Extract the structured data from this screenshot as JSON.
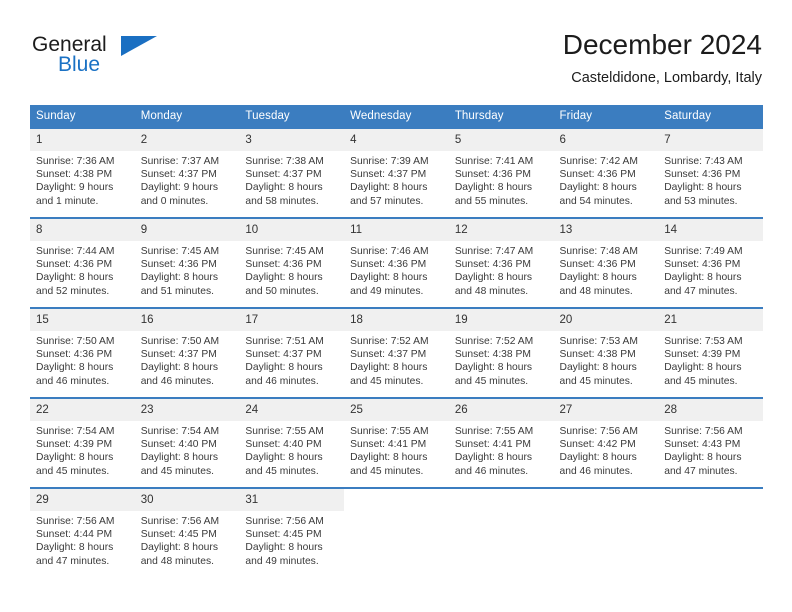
{
  "brand": {
    "word_top": "General",
    "word_bottom": "Blue",
    "accent_color": "#1a6fc2",
    "logo_icon": "triangle-logo-icon"
  },
  "header": {
    "month_title": "December 2024",
    "location": "Casteldidone, Lombardy, Italy"
  },
  "calendar": {
    "header_bg": "#3b7dc0",
    "daynum_bg": "#f0f0f0",
    "weekday_headers": [
      "Sunday",
      "Monday",
      "Tuesday",
      "Wednesday",
      "Thursday",
      "Friday",
      "Saturday"
    ],
    "weeks": [
      [
        {
          "day": "1",
          "sunrise": "Sunrise: 7:36 AM",
          "sunset": "Sunset: 4:38 PM",
          "daylight_line1": "Daylight: 9 hours",
          "daylight_line2": "and 1 minute."
        },
        {
          "day": "2",
          "sunrise": "Sunrise: 7:37 AM",
          "sunset": "Sunset: 4:37 PM",
          "daylight_line1": "Daylight: 9 hours",
          "daylight_line2": "and 0 minutes."
        },
        {
          "day": "3",
          "sunrise": "Sunrise: 7:38 AM",
          "sunset": "Sunset: 4:37 PM",
          "daylight_line1": "Daylight: 8 hours",
          "daylight_line2": "and 58 minutes."
        },
        {
          "day": "4",
          "sunrise": "Sunrise: 7:39 AM",
          "sunset": "Sunset: 4:37 PM",
          "daylight_line1": "Daylight: 8 hours",
          "daylight_line2": "and 57 minutes."
        },
        {
          "day": "5",
          "sunrise": "Sunrise: 7:41 AM",
          "sunset": "Sunset: 4:36 PM",
          "daylight_line1": "Daylight: 8 hours",
          "daylight_line2": "and 55 minutes."
        },
        {
          "day": "6",
          "sunrise": "Sunrise: 7:42 AM",
          "sunset": "Sunset: 4:36 PM",
          "daylight_line1": "Daylight: 8 hours",
          "daylight_line2": "and 54 minutes."
        },
        {
          "day": "7",
          "sunrise": "Sunrise: 7:43 AM",
          "sunset": "Sunset: 4:36 PM",
          "daylight_line1": "Daylight: 8 hours",
          "daylight_line2": "and 53 minutes."
        }
      ],
      [
        {
          "day": "8",
          "sunrise": "Sunrise: 7:44 AM",
          "sunset": "Sunset: 4:36 PM",
          "daylight_line1": "Daylight: 8 hours",
          "daylight_line2": "and 52 minutes."
        },
        {
          "day": "9",
          "sunrise": "Sunrise: 7:45 AM",
          "sunset": "Sunset: 4:36 PM",
          "daylight_line1": "Daylight: 8 hours",
          "daylight_line2": "and 51 minutes."
        },
        {
          "day": "10",
          "sunrise": "Sunrise: 7:45 AM",
          "sunset": "Sunset: 4:36 PM",
          "daylight_line1": "Daylight: 8 hours",
          "daylight_line2": "and 50 minutes."
        },
        {
          "day": "11",
          "sunrise": "Sunrise: 7:46 AM",
          "sunset": "Sunset: 4:36 PM",
          "daylight_line1": "Daylight: 8 hours",
          "daylight_line2": "and 49 minutes."
        },
        {
          "day": "12",
          "sunrise": "Sunrise: 7:47 AM",
          "sunset": "Sunset: 4:36 PM",
          "daylight_line1": "Daylight: 8 hours",
          "daylight_line2": "and 48 minutes."
        },
        {
          "day": "13",
          "sunrise": "Sunrise: 7:48 AM",
          "sunset": "Sunset: 4:36 PM",
          "daylight_line1": "Daylight: 8 hours",
          "daylight_line2": "and 48 minutes."
        },
        {
          "day": "14",
          "sunrise": "Sunrise: 7:49 AM",
          "sunset": "Sunset: 4:36 PM",
          "daylight_line1": "Daylight: 8 hours",
          "daylight_line2": "and 47 minutes."
        }
      ],
      [
        {
          "day": "15",
          "sunrise": "Sunrise: 7:50 AM",
          "sunset": "Sunset: 4:36 PM",
          "daylight_line1": "Daylight: 8 hours",
          "daylight_line2": "and 46 minutes."
        },
        {
          "day": "16",
          "sunrise": "Sunrise: 7:50 AM",
          "sunset": "Sunset: 4:37 PM",
          "daylight_line1": "Daylight: 8 hours",
          "daylight_line2": "and 46 minutes."
        },
        {
          "day": "17",
          "sunrise": "Sunrise: 7:51 AM",
          "sunset": "Sunset: 4:37 PM",
          "daylight_line1": "Daylight: 8 hours",
          "daylight_line2": "and 46 minutes."
        },
        {
          "day": "18",
          "sunrise": "Sunrise: 7:52 AM",
          "sunset": "Sunset: 4:37 PM",
          "daylight_line1": "Daylight: 8 hours",
          "daylight_line2": "and 45 minutes."
        },
        {
          "day": "19",
          "sunrise": "Sunrise: 7:52 AM",
          "sunset": "Sunset: 4:38 PM",
          "daylight_line1": "Daylight: 8 hours",
          "daylight_line2": "and 45 minutes."
        },
        {
          "day": "20",
          "sunrise": "Sunrise: 7:53 AM",
          "sunset": "Sunset: 4:38 PM",
          "daylight_line1": "Daylight: 8 hours",
          "daylight_line2": "and 45 minutes."
        },
        {
          "day": "21",
          "sunrise": "Sunrise: 7:53 AM",
          "sunset": "Sunset: 4:39 PM",
          "daylight_line1": "Daylight: 8 hours",
          "daylight_line2": "and 45 minutes."
        }
      ],
      [
        {
          "day": "22",
          "sunrise": "Sunrise: 7:54 AM",
          "sunset": "Sunset: 4:39 PM",
          "daylight_line1": "Daylight: 8 hours",
          "daylight_line2": "and 45 minutes."
        },
        {
          "day": "23",
          "sunrise": "Sunrise: 7:54 AM",
          "sunset": "Sunset: 4:40 PM",
          "daylight_line1": "Daylight: 8 hours",
          "daylight_line2": "and 45 minutes."
        },
        {
          "day": "24",
          "sunrise": "Sunrise: 7:55 AM",
          "sunset": "Sunset: 4:40 PM",
          "daylight_line1": "Daylight: 8 hours",
          "daylight_line2": "and 45 minutes."
        },
        {
          "day": "25",
          "sunrise": "Sunrise: 7:55 AM",
          "sunset": "Sunset: 4:41 PM",
          "daylight_line1": "Daylight: 8 hours",
          "daylight_line2": "and 45 minutes."
        },
        {
          "day": "26",
          "sunrise": "Sunrise: 7:55 AM",
          "sunset": "Sunset: 4:41 PM",
          "daylight_line1": "Daylight: 8 hours",
          "daylight_line2": "and 46 minutes."
        },
        {
          "day": "27",
          "sunrise": "Sunrise: 7:56 AM",
          "sunset": "Sunset: 4:42 PM",
          "daylight_line1": "Daylight: 8 hours",
          "daylight_line2": "and 46 minutes."
        },
        {
          "day": "28",
          "sunrise": "Sunrise: 7:56 AM",
          "sunset": "Sunset: 4:43 PM",
          "daylight_line1": "Daylight: 8 hours",
          "daylight_line2": "and 47 minutes."
        }
      ],
      [
        {
          "day": "29",
          "sunrise": "Sunrise: 7:56 AM",
          "sunset": "Sunset: 4:44 PM",
          "daylight_line1": "Daylight: 8 hours",
          "daylight_line2": "and 47 minutes."
        },
        {
          "day": "30",
          "sunrise": "Sunrise: 7:56 AM",
          "sunset": "Sunset: 4:45 PM",
          "daylight_line1": "Daylight: 8 hours",
          "daylight_line2": "and 48 minutes."
        },
        {
          "day": "31",
          "sunrise": "Sunrise: 7:56 AM",
          "sunset": "Sunset: 4:45 PM",
          "daylight_line1": "Daylight: 8 hours",
          "daylight_line2": "and 49 minutes."
        },
        {
          "day": "",
          "sunrise": "",
          "sunset": "",
          "daylight_line1": "",
          "daylight_line2": ""
        },
        {
          "day": "",
          "sunrise": "",
          "sunset": "",
          "daylight_line1": "",
          "daylight_line2": ""
        },
        {
          "day": "",
          "sunrise": "",
          "sunset": "",
          "daylight_line1": "",
          "daylight_line2": ""
        },
        {
          "day": "",
          "sunrise": "",
          "sunset": "",
          "daylight_line1": "",
          "daylight_line2": ""
        }
      ]
    ]
  }
}
